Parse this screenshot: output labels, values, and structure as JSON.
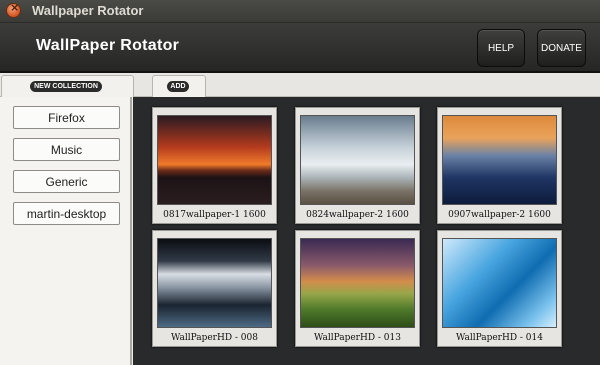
{
  "window": {
    "title": "Wallpaper Rotator"
  },
  "header": {
    "app_title": "WallPaper Rotator",
    "help_label": "HELP",
    "donate_label": "DONATE"
  },
  "tabs": [
    {
      "label": "NEW COLLECTION"
    },
    {
      "label": "ADD"
    }
  ],
  "collections": [
    {
      "label": "Firefox"
    },
    {
      "label": "Music"
    },
    {
      "label": "Generic"
    },
    {
      "label": "martin-desktop"
    }
  ],
  "wallpapers": [
    {
      "caption": "0817wallpaper-1  1600"
    },
    {
      "caption": "0824wallpaper-2  1600"
    },
    {
      "caption": "0907wallpaper-2  1600"
    },
    {
      "caption": "WallPaperHD - 008"
    },
    {
      "caption": "WallPaperHD - 013"
    },
    {
      "caption": "WallPaperHD - 014"
    }
  ],
  "colors": {
    "header_bg": "#262625",
    "grid_bg": "#282a2c",
    "sidebar_bg": "#f4f3f0"
  }
}
